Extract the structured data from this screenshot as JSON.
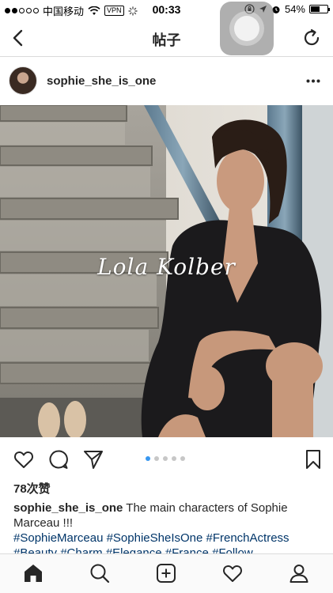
{
  "status_bar": {
    "carrier": "中国移动",
    "vpn": "VPN",
    "time": "00:33",
    "battery_text": "54%",
    "battery_level": 0.54
  },
  "nav": {
    "title": "帖子",
    "back_icon": "chevron-left-icon",
    "refresh_icon": "refresh-icon"
  },
  "post": {
    "username": "sophie_she_is_one",
    "photo_text": "Lola Kolber",
    "carousel_count": 5,
    "carousel_active": 1,
    "likes": "78次赞",
    "caption_user": "sophie_she_is_one",
    "caption_text": " The main characters of Sophie Marceau !!!",
    "hashtags": "#SophieMarceau #SophieSheIsOne #FrenchActress #Beauty #Charm #Elegance #France #Follow"
  },
  "colors": {
    "link": "#003569",
    "carousel_active": "#3897f0",
    "divider": "#dbdbdb"
  }
}
